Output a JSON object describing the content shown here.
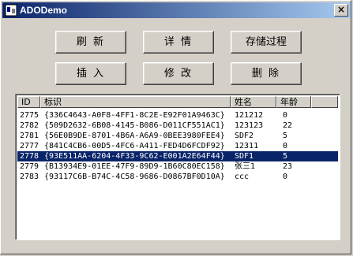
{
  "window": {
    "title": "ADODemo",
    "close_label": "×"
  },
  "buttons": {
    "refresh": "刷 新",
    "details": "详 情",
    "stored_proc": "存储过程",
    "insert": "插 入",
    "modify": "修 改",
    "delete": "删 除"
  },
  "list": {
    "headers": {
      "id": "ID",
      "guid": "标识",
      "name": "姓名",
      "age": "年龄"
    },
    "selected_index": 4,
    "rows": [
      {
        "id": "2775",
        "guid": "{336C4643-A0F8-4FF1-8C2E-E92F01A9463C}",
        "name": "121212",
        "age": "0"
      },
      {
        "id": "2782",
        "guid": "{509D2632-6B08-4145-B086-D011CF551AC1}",
        "name": "123123",
        "age": "22"
      },
      {
        "id": "2781",
        "guid": "{56E0B9DE-8701-4B6A-A6A9-0BEE3980FEE4}",
        "name": "SDF2",
        "age": "5"
      },
      {
        "id": "2777",
        "guid": "{841C4CB6-00D5-4FC6-A411-FED4D6FCDF92}",
        "name": "12311",
        "age": "0"
      },
      {
        "id": "2778",
        "guid": "{93E511AA-6204-4F33-9C62-E001A2E64F44}",
        "name": "SDF1",
        "age": "5"
      },
      {
        "id": "2779",
        "guid": "{B13934E9-01EE-47F9-89D9-1B60C80EC158}",
        "name": "张三1",
        "age": "23"
      },
      {
        "id": "2783",
        "guid": "{93117C6B-B74C-4C58-9686-D0867BF0D10A}",
        "name": "ccc",
        "age": "0"
      }
    ]
  }
}
